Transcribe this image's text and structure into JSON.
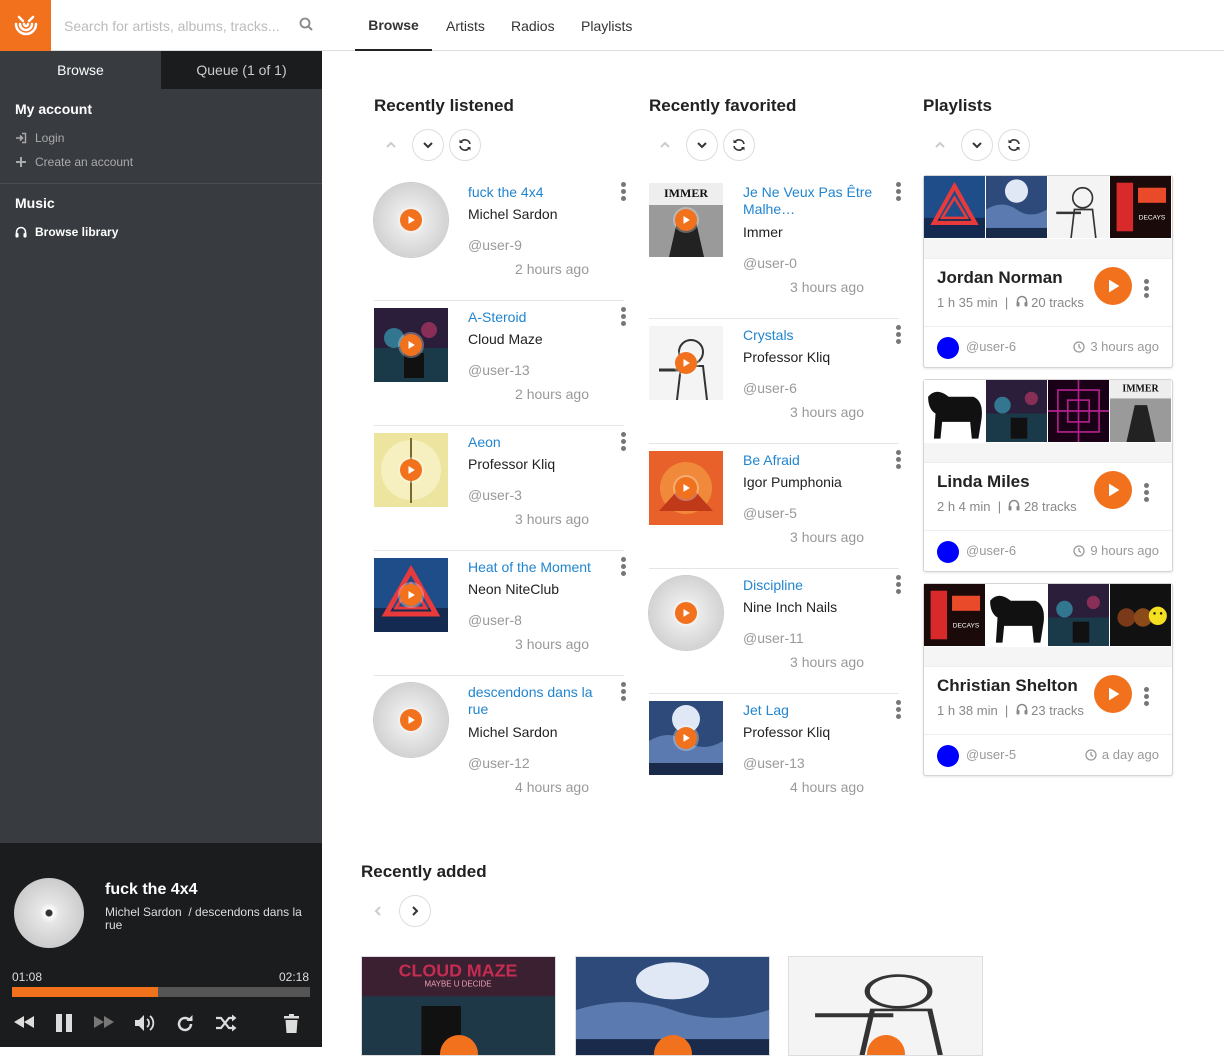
{
  "colors": {
    "accent": "#f2711c",
    "link": "#2185d0",
    "sidebar": "#383b40",
    "dark": "#1b1c1d"
  },
  "search": {
    "placeholder": "Search for artists, albums, tracks..."
  },
  "sidebar": {
    "tabs": {
      "browse": "Browse",
      "queue": "Queue (1 of 1)"
    },
    "account": {
      "title": "My account",
      "login": "Login",
      "create": "Create an account"
    },
    "music": {
      "title": "Music",
      "browse": "Browse library"
    }
  },
  "player": {
    "title": "fuck the 4x4",
    "artist": "Michel Sardon",
    "album": "/ descendons dans la rue",
    "current": "01:08",
    "total": "02:18",
    "progress": 0.49,
    "buffer": 0.95
  },
  "nav": {
    "browse": "Browse",
    "artists": "Artists",
    "radios": "Radios",
    "playlists": "Playlists"
  },
  "sections": {
    "listened": "Recently listened",
    "favorited": "Recently favorited",
    "playlists": "Playlists",
    "added": "Recently added"
  },
  "listened": [
    {
      "title": "fuck the 4x4",
      "artist": "Michel Sardon",
      "user": "@user-9",
      "time": "2 hours ago",
      "cover": "disc"
    },
    {
      "title": "A-Steroid",
      "artist": "Cloud Maze",
      "user": "@user-13",
      "time": "2 hours ago",
      "cover": "neon"
    },
    {
      "title": "Aeon",
      "artist": "Professor Kliq",
      "user": "@user-3",
      "time": "3 hours ago",
      "cover": "yellow"
    },
    {
      "title": "Heat of the Moment",
      "artist": "Neon NiteClub",
      "user": "@user-8",
      "time": "3 hours ago",
      "cover": "triangle"
    },
    {
      "title": "descendons dans la rue",
      "artist": "Michel Sardon",
      "user": "@user-12",
      "time": "4 hours ago",
      "cover": "disc"
    }
  ],
  "favorited": [
    {
      "title": "Je Ne Veux Pas Être Malhe…",
      "artist": "Immer",
      "user": "@user-0",
      "time": "3 hours ago",
      "cover": "immer"
    },
    {
      "title": "Crystals",
      "artist": "Professor Kliq",
      "user": "@user-6",
      "time": "3 hours ago",
      "cover": "sketch"
    },
    {
      "title": "Be Afraid",
      "artist": "Igor Pumphonia",
      "user": "@user-5",
      "time": "3 hours ago",
      "cover": "orange"
    },
    {
      "title": "Discipline",
      "artist": "Nine Inch Nails",
      "user": "@user-11",
      "time": "3 hours ago",
      "cover": "disc"
    },
    {
      "title": "Jet Lag",
      "artist": "Professor Kliq",
      "user": "@user-13",
      "time": "4 hours ago",
      "cover": "sky"
    }
  ],
  "playlists": [
    {
      "name": "Jordan Norman",
      "duration": "1 h 35 min",
      "tracks": "20 tracks",
      "user": "@user-6",
      "time": "3 hours ago",
      "covers": [
        "triangle",
        "sky",
        "sketch",
        "sign"
      ]
    },
    {
      "name": "Linda Miles",
      "duration": "2 h 4 min",
      "tracks": "28 tracks",
      "user": "@user-6",
      "time": "9 hours ago",
      "covers": [
        "cat",
        "neon",
        "pattern",
        "immer"
      ]
    },
    {
      "name": "Christian Shelton",
      "duration": "1 h 38 min",
      "tracks": "23 tracks",
      "user": "@user-5",
      "time": "a day ago",
      "covers": [
        "sign",
        "cat",
        "neon",
        "smiley"
      ]
    }
  ],
  "added": [
    {
      "cover": "neonbig"
    },
    {
      "cover": "sky"
    },
    {
      "cover": "sketch"
    }
  ],
  "icons": [
    "logo-icon",
    "search-icon",
    "login-icon",
    "plus-icon",
    "headphones-icon",
    "chevron-up-icon",
    "chevron-down-icon",
    "refresh-icon",
    "play-icon",
    "more-icon",
    "clock-icon",
    "backward-icon",
    "pause-icon",
    "forward-icon",
    "volume-icon",
    "repeat-icon",
    "shuffle-icon",
    "trash-icon",
    "chevron-left-icon",
    "chevron-right-icon"
  ]
}
